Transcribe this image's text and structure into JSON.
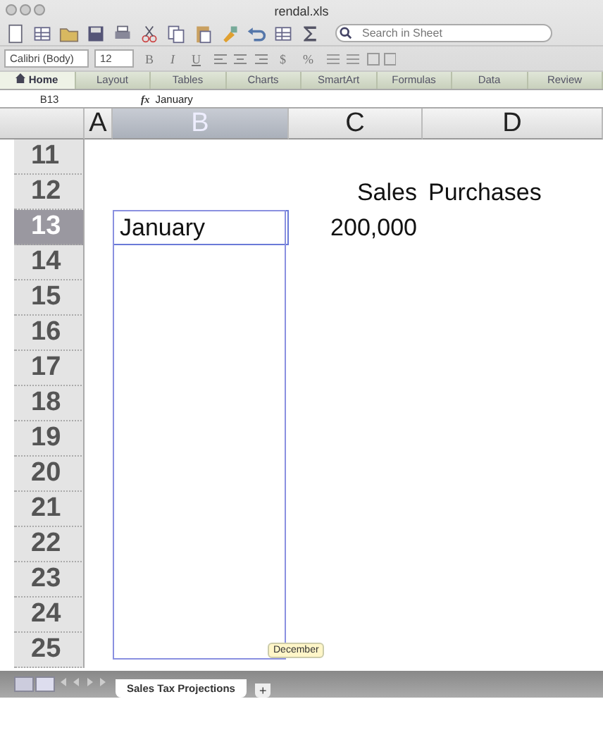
{
  "window": {
    "title": "rendal.xls"
  },
  "toolbar": {
    "search": {
      "placeholder": "Search in Sheet"
    }
  },
  "format_bar": {
    "font": "Calibri (Body)",
    "size": "12",
    "style_buttons": [
      "B",
      "I",
      "U"
    ],
    "number_buttons": [
      "$",
      "%"
    ]
  },
  "ribbon_tabs": [
    {
      "label": "Home",
      "selected": true
    },
    {
      "label": "Layout",
      "selected": false
    },
    {
      "label": "Tables",
      "selected": false
    },
    {
      "label": "Charts",
      "selected": false
    },
    {
      "label": "SmartArt",
      "selected": false
    },
    {
      "label": "Formulas",
      "selected": false
    },
    {
      "label": "Data",
      "selected": false
    },
    {
      "label": "Review",
      "selected": false
    }
  ],
  "formula_bar": {
    "name_box": "B13",
    "fx": "fx",
    "value": "January"
  },
  "columns": [
    {
      "label": "A",
      "selected": false
    },
    {
      "label": "B",
      "selected": true
    },
    {
      "label": "C",
      "selected": false
    },
    {
      "label": "D",
      "selected": false
    }
  ],
  "rows": [
    {
      "label": "11",
      "selected": false
    },
    {
      "label": "12",
      "selected": false,
      "column_c": "Sales",
      "column_d": "Purchases"
    },
    {
      "label": "13",
      "selected": true,
      "column_b": "January",
      "column_c": "200,000"
    },
    {
      "label": "14",
      "selected": false
    },
    {
      "label": "15",
      "selected": false
    },
    {
      "label": "16",
      "selected": false
    },
    {
      "label": "17",
      "selected": false
    },
    {
      "label": "18",
      "selected": false
    },
    {
      "label": "19",
      "selected": false
    },
    {
      "label": "20",
      "selected": false
    },
    {
      "label": "21",
      "selected": false
    },
    {
      "label": "22",
      "selected": false
    },
    {
      "label": "23",
      "selected": false
    },
    {
      "label": "24",
      "selected": false
    },
    {
      "label": "25",
      "selected": false
    }
  ],
  "fill_tooltip": "December",
  "sheet_tabs": [
    {
      "label": "Sales Tax Projections",
      "selected": true
    }
  ],
  "add_sheet": "+"
}
